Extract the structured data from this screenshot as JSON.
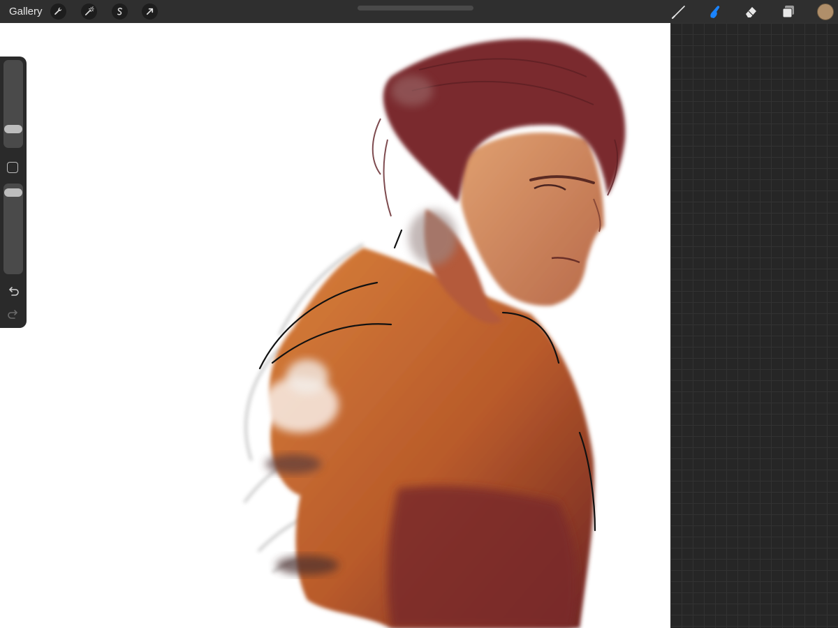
{
  "topbar": {
    "gallery_label": "Gallery",
    "left_tools": [
      {
        "name": "actions",
        "icon": "wrench-icon"
      },
      {
        "name": "adjustments",
        "icon": "magic-wand-icon"
      },
      {
        "name": "selection",
        "icon": "selection-s-icon"
      },
      {
        "name": "transform",
        "icon": "arrow-icon"
      }
    ],
    "right_tools": [
      {
        "name": "brush",
        "icon": "brush-icon",
        "active": false
      },
      {
        "name": "smudge",
        "icon": "smudge-finger-icon",
        "active": true
      },
      {
        "name": "eraser",
        "icon": "eraser-icon",
        "active": false
      },
      {
        "name": "layers",
        "icon": "layers-icon",
        "active": false
      }
    ],
    "current_color": "#b08f6a",
    "active_tool_color": "#1a84ff"
  },
  "sidebar": {
    "brush_size_level": 0.82,
    "opacity_level": 0.06,
    "icons": [
      "modify-square-icon",
      "undo-icon",
      "redo-icon"
    ]
  },
  "canvas": {
    "background": "#ffffff",
    "artwork": "digital-painting-portrait"
  }
}
